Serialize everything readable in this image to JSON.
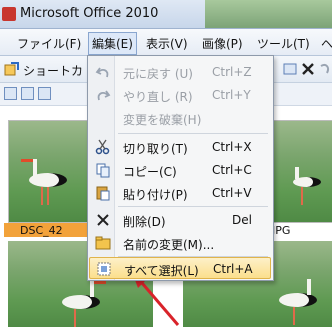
{
  "window": {
    "title": "Microsoft Office 2010"
  },
  "menubar": {
    "items": [
      {
        "label": "ファイル(F)"
      },
      {
        "label": "編集(E)"
      },
      {
        "label": "表示(V)"
      },
      {
        "label": "画像(P)"
      },
      {
        "label": "ツール(T)"
      },
      {
        "label": "ヘ"
      }
    ]
  },
  "toolbar": {
    "shortcut_label": "ショートカ"
  },
  "thumbnails": {
    "captions": [
      "DSC_42",
      "JPG"
    ]
  },
  "edit_menu": {
    "items": [
      {
        "label": "元に戻す (U)",
        "key": "Ctrl+Z",
        "icon": "undo-icon",
        "disabled": true
      },
      {
        "label": "やり直し (R)",
        "key": "Ctrl+Y",
        "icon": "redo-icon",
        "disabled": true
      },
      {
        "label": "変更を破棄(H)",
        "key": "",
        "icon": "",
        "disabled": true
      },
      {
        "label": "切り取り(T)",
        "key": "Ctrl+X",
        "icon": "scissors-icon",
        "disabled": false
      },
      {
        "label": "コピー(C)",
        "key": "Ctrl+C",
        "icon": "copy-icon",
        "disabled": false
      },
      {
        "label": "貼り付け(P)",
        "key": "Ctrl+V",
        "icon": "paste-icon",
        "disabled": false
      },
      {
        "label": "削除(D)",
        "key": "Del",
        "icon": "delete-x-icon",
        "disabled": false
      },
      {
        "label": "名前の変更(M)...",
        "key": "",
        "icon": "rename-icon",
        "disabled": false
      },
      {
        "label": "すべて選択(L)",
        "key": "Ctrl+A",
        "icon": "select-all-icon",
        "disabled": false,
        "highlighted": true
      }
    ]
  },
  "colors": {
    "highlight": "#fbdf8d",
    "selected_caption": "#f2a23a",
    "pointer": "#d9232a"
  }
}
